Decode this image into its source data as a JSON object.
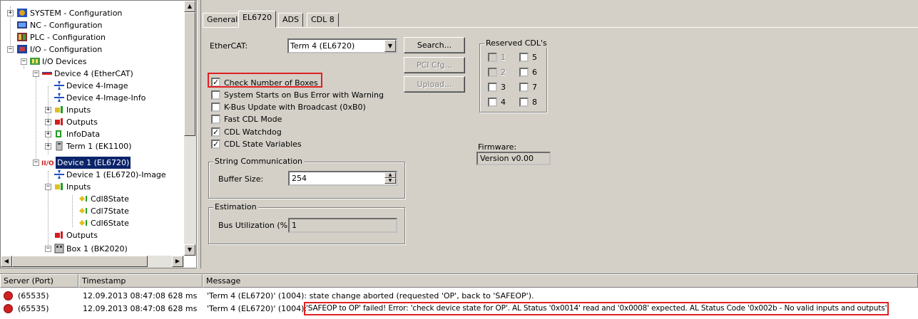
{
  "tree": {
    "items": [
      {
        "label": "SYSTEM - Configuration"
      },
      {
        "label": "NC - Configuration"
      },
      {
        "label": "PLC - Configuration"
      },
      {
        "label": "I/O - Configuration"
      },
      {
        "label": "I/O Devices"
      },
      {
        "label": "Device 4 (EtherCAT)"
      },
      {
        "label": "Device 4-Image"
      },
      {
        "label": "Device 4-Image-Info"
      },
      {
        "label": "Inputs"
      },
      {
        "label": "Outputs"
      },
      {
        "label": "InfoData"
      },
      {
        "label": "Term 1 (EK1100)"
      },
      {
        "label": "Device 1 (EL6720)"
      },
      {
        "label": "Device 1 (EL6720)-Image"
      },
      {
        "label": "Inputs"
      },
      {
        "label": "Cdl8State"
      },
      {
        "label": "Cdl7State"
      },
      {
        "label": "Cdl6State"
      },
      {
        "label": "Outputs"
      },
      {
        "label": "Box 1 (BK2020)"
      }
    ]
  },
  "tabs": [
    {
      "label": "General"
    },
    {
      "label": "EL6720"
    },
    {
      "label": "ADS"
    },
    {
      "label": "CDL 8"
    }
  ],
  "settings": {
    "ethercat_label": "EtherCAT:",
    "ethercat_value": "Term 4 (EL6720)",
    "search_button": "Search...",
    "pci_button": "PCI Cfg...",
    "upload_button": "Upload...",
    "options": [
      {
        "label": "Check Number of Boxes",
        "checked": true
      },
      {
        "label": "System Starts on Bus Error with Warning",
        "checked": false
      },
      {
        "label": "K-Bus Update with Broadcast (0xB0)",
        "checked": false
      },
      {
        "label": "Fast CDL Mode",
        "checked": false
      },
      {
        "label": "CDL Watchdog",
        "checked": true
      },
      {
        "label": "CDL State Variables",
        "checked": true
      }
    ],
    "reserved_title": "Reserved CDL's",
    "reserved": [
      {
        "label": "1",
        "enabled": false
      },
      {
        "label": "5",
        "enabled": true
      },
      {
        "label": "2",
        "enabled": false
      },
      {
        "label": "6",
        "enabled": true
      },
      {
        "label": "3",
        "enabled": true
      },
      {
        "label": "7",
        "enabled": true
      },
      {
        "label": "4",
        "enabled": true
      },
      {
        "label": "8",
        "enabled": true
      }
    ],
    "firmware_label": "Firmware:",
    "firmware_value": "Version v0.00",
    "string_comm_title": "String Communication",
    "buffer_label": "Buffer Size:",
    "buffer_value": "254",
    "estimation_title": "Estimation",
    "bus_util_label": "Bus Utilization (%):",
    "bus_util_value": "1"
  },
  "log": {
    "columns": [
      "Server (Port)",
      "Timestamp",
      "Message"
    ],
    "rows": [
      {
        "server": "(65535)",
        "timestamp": "12.09.2013 08:47:08 628 ms",
        "message_prefix": "'Term 4 (EL6720)' (1004): state change aborted (requested 'OP', back to 'SAFEOP').",
        "message_highlight": ""
      },
      {
        "server": "(65535)",
        "timestamp": "12.09.2013 08:47:08 628 ms",
        "message_prefix": "'Term 4 (EL6720)' (1004): ",
        "message_highlight": "'SAFEOP to OP' failed! Error: 'check device state for OP'. AL Status '0x0014' read and '0x0008' expected. AL Status Code '0x002b - No valid inputs and outputs'"
      }
    ]
  },
  "colors": {
    "selection": "#0a246a",
    "highlight_box": "#e02020",
    "error_icon": "#d02020"
  }
}
